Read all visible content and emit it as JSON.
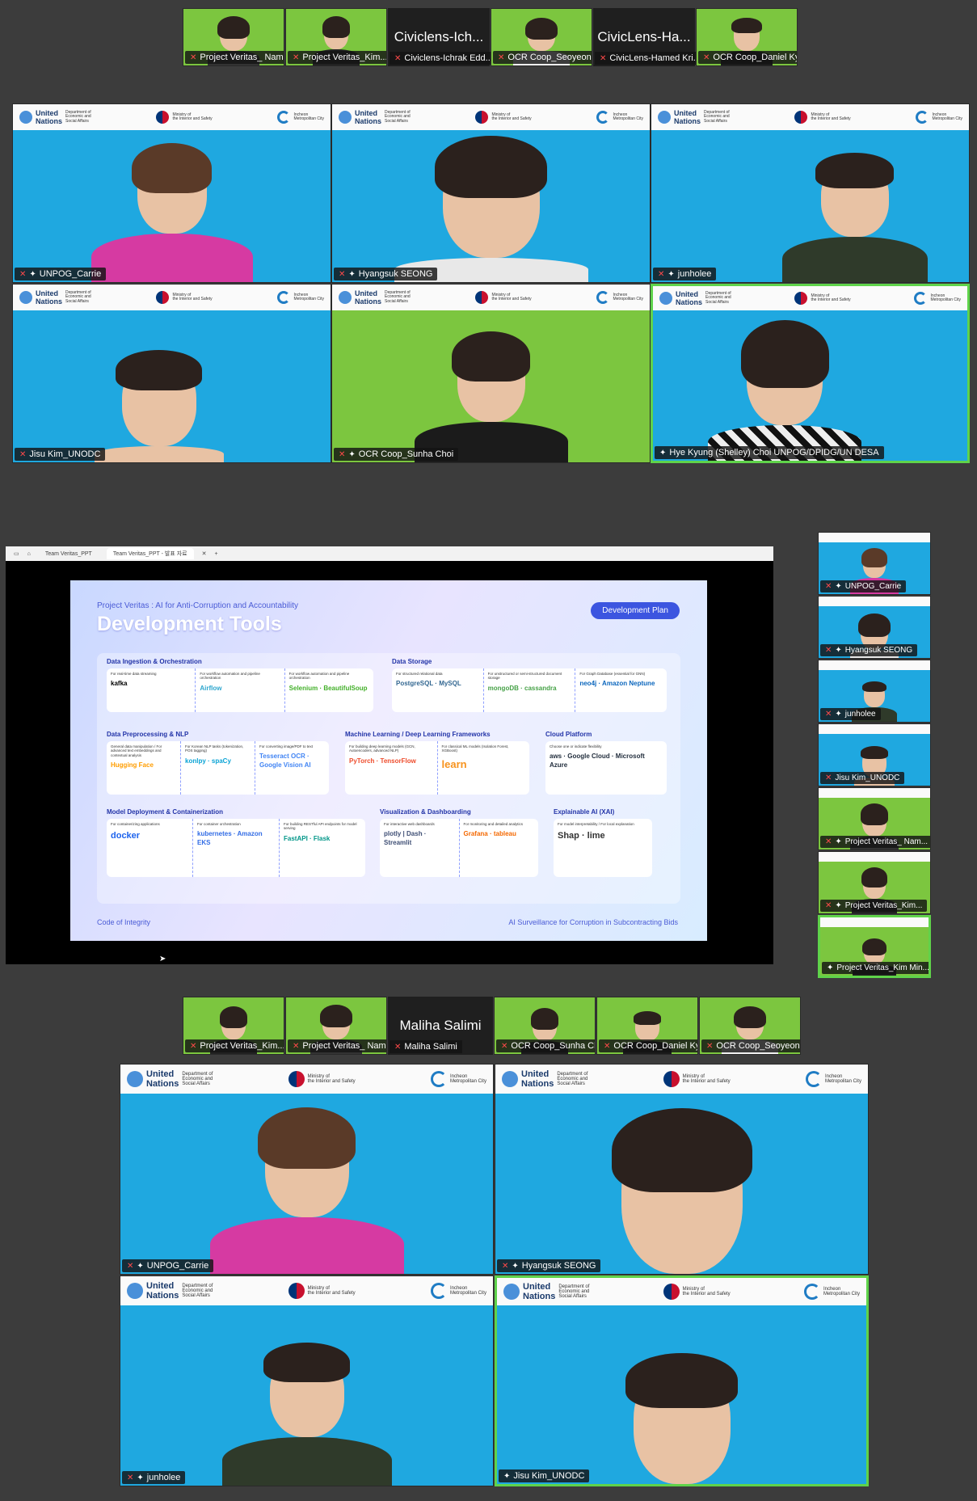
{
  "top_strip": [
    {
      "name": "Project Veritas_ Nam...",
      "bg": "green",
      "kind": "video"
    },
    {
      "name": "Project Veritas_Kim...",
      "bg": "green",
      "kind": "video"
    },
    {
      "name": "Civiclens-Ichrak Edd...",
      "big": "Civiclens-Ich...",
      "kind": "nameonly"
    },
    {
      "name": "OCR Coop_Seoyeon...",
      "bg": "green",
      "kind": "video"
    },
    {
      "name": "CivicLens-Hamed Kri...",
      "big": "CivicLens-Ha...",
      "kind": "nameonly"
    },
    {
      "name": "OCR Coop_Daniel Ky...",
      "bg": "green",
      "kind": "video"
    }
  ],
  "grid1": [
    {
      "name": "UNPOG_Carrie"
    },
    {
      "name": "Hyangsuk SEONG"
    },
    {
      "name": "junholee"
    },
    {
      "name": "Jisu Kim_UNODC"
    },
    {
      "name": "OCR Coop_Sunha Choi"
    },
    {
      "name": "Hye Kyung (Shelley) Choi UNPOG/DPIDG/UN DESA"
    }
  ],
  "banner": {
    "un_line1": "United",
    "un_line2": "Nations",
    "desa_line1": "Department of",
    "desa_line2": "Economic and",
    "desa_line3": "Social Affairs",
    "mois_line1": "Ministry of",
    "mois_line2": "the Interior and Safety",
    "incheon_line1": "Incheon",
    "incheon_line2": "Metropolitan City"
  },
  "browser": {
    "tab1": "Team Veritas_PPT",
    "tab2": "Team Veritas_PPT - 발표 자료"
  },
  "slide": {
    "subtitle": "Project Veritas : AI for Anti-Corruption and Accountability",
    "title": "Development Tools",
    "badge": "Development Plan",
    "footer_left": "Code of Integrity",
    "footer_right": "AI Surveillance for Corruption in Subcontracting Bids",
    "sections": [
      {
        "title": "Data Ingestion & Orchestration",
        "cols": [
          {
            "cap": "For real-time data streaming",
            "tools": "kafka"
          },
          {
            "cap": "For workflow automation and pipeline orchestration",
            "tools": "Airflow"
          },
          {
            "cap": "For workflow automation and pipeline orchestration",
            "tools": "Selenium · BeautifulSoup"
          }
        ]
      },
      {
        "title": "Data Storage",
        "cols": [
          {
            "cap": "For structured relational data",
            "tools": "PostgreSQL · MySQL"
          },
          {
            "cap": "For unstructured or semi-structured document storage",
            "tools": "mongoDB · cassandra"
          },
          {
            "cap": "For Graph Database (essential for GNN)",
            "tools": "neo4j · Amazon Neptune"
          }
        ]
      },
      {
        "title": "Data Preprocessing & NLP",
        "cols": [
          {
            "cap": "General data manipulation / For advanced text embeddings and contextual analysis",
            "tools": "Hugging Face"
          },
          {
            "cap": "For Korean NLP tasks (tokenization, POS tagging)",
            "tools": "konlpy · spaCy"
          },
          {
            "cap": "For converting image/PDF to text",
            "tools": "Tesseract OCR · Google Vision AI"
          }
        ]
      },
      {
        "title": "Machine Learning / Deep Learning Frameworks",
        "cols": [
          {
            "cap": "For building deep learning models (GCN, Autoencoders, advanced NLP)",
            "tools": "PyTorch · TensorFlow"
          },
          {
            "cap": "For classical ML models (Isolation Forest, XGBoost)",
            "tools": "learn"
          }
        ]
      },
      {
        "title": "Cloud Platform",
        "cols": [
          {
            "cap": "Choose one or indicate flexibility",
            "tools": "aws · Google Cloud · Microsoft Azure"
          }
        ]
      },
      {
        "title": "Model Deployment & Containerization",
        "cols": [
          {
            "cap": "For containerizing applications",
            "tools": "docker"
          },
          {
            "cap": "For container orchestration",
            "tools": "kubernetes · Amazon EKS"
          },
          {
            "cap": "For building RESTful API endpoints for model serving",
            "tools": "FastAPI · Flask"
          }
        ]
      },
      {
        "title": "Visualization & Dashboarding",
        "cols": [
          {
            "cap": "For interactive web dashboards",
            "tools": "plotly | Dash · Streamlit"
          },
          {
            "cap": "For monitoring and detailed analytics",
            "tools": "Grafana · tableau"
          }
        ]
      },
      {
        "title": "Explainable AI (XAI)",
        "cols": [
          {
            "cap": "For model interpretability / For local explanation",
            "tools": "Shap · lime"
          }
        ]
      }
    ]
  },
  "side_panel": [
    {
      "name": "UNPOG_Carrie"
    },
    {
      "name": "Hyangsuk SEONG"
    },
    {
      "name": "junholee"
    },
    {
      "name": "Jisu Kim_UNODC"
    },
    {
      "name": "Project Veritas_ Nam..."
    },
    {
      "name": "Project Veritas_Kim..."
    },
    {
      "name": "Project Veritas_Kim Min..."
    }
  ],
  "bottom_strip": [
    {
      "name": "Project Veritas_Kim..."
    },
    {
      "name": "Project Veritas_ Nam..."
    },
    {
      "name": "Maliha Salimi",
      "big": "Maliha Salimi"
    },
    {
      "name": "OCR Coop_Sunha Choi"
    },
    {
      "name": "OCR Coop_Daniel Ky..."
    },
    {
      "name": "OCR Coop_Seoyeon..."
    }
  ],
  "grid2": [
    {
      "name": "UNPOG_Carrie"
    },
    {
      "name": "Hyangsuk SEONG"
    },
    {
      "name": "junholee"
    },
    {
      "name": "Jisu Kim_UNODC"
    }
  ],
  "colors": {
    "blue_bg": "#1fa8e0",
    "green_bg": "#7cc63f",
    "active_border": "#5fd34a",
    "slide_accent": "#3c55e0"
  }
}
